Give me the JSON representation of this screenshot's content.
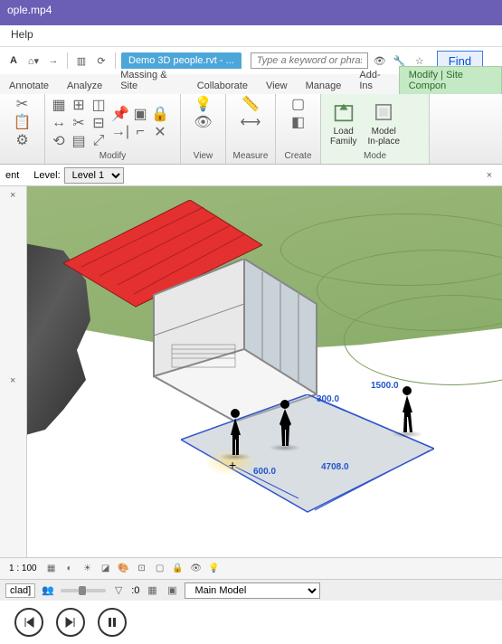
{
  "player": {
    "title": "ople.mp4"
  },
  "menubar": {
    "help": "Help"
  },
  "qat": {
    "doc_tab": "Demo 3D people.rvt - ...",
    "search_placeholder": "Type a keyword or phrase",
    "find": "Find"
  },
  "ribbon_tabs": [
    "Annotate",
    "Analyze",
    "Massing & Site",
    "Collaborate",
    "View",
    "Manage",
    "Add-Ins",
    "Modify | Site Compon"
  ],
  "ribbon_active_index": 7,
  "panels": {
    "modify": "Modify",
    "view": "View",
    "measure": "Measure",
    "create": "Create",
    "mode": "Mode",
    "load_family": "Load\nFamily",
    "model_inplace": "Model\nIn-place"
  },
  "level_bar": {
    "ent": "ent",
    "level_label": "Level:",
    "level_value": "Level 1"
  },
  "dims": {
    "d1": "1500.0",
    "d2": "300.0",
    "d3": "600.0",
    "d4": "4708.0"
  },
  "status": {
    "scale": "1 : 100"
  },
  "bottom": {
    "clad": "clad]",
    "zero": ":0",
    "model": "Main Model"
  }
}
